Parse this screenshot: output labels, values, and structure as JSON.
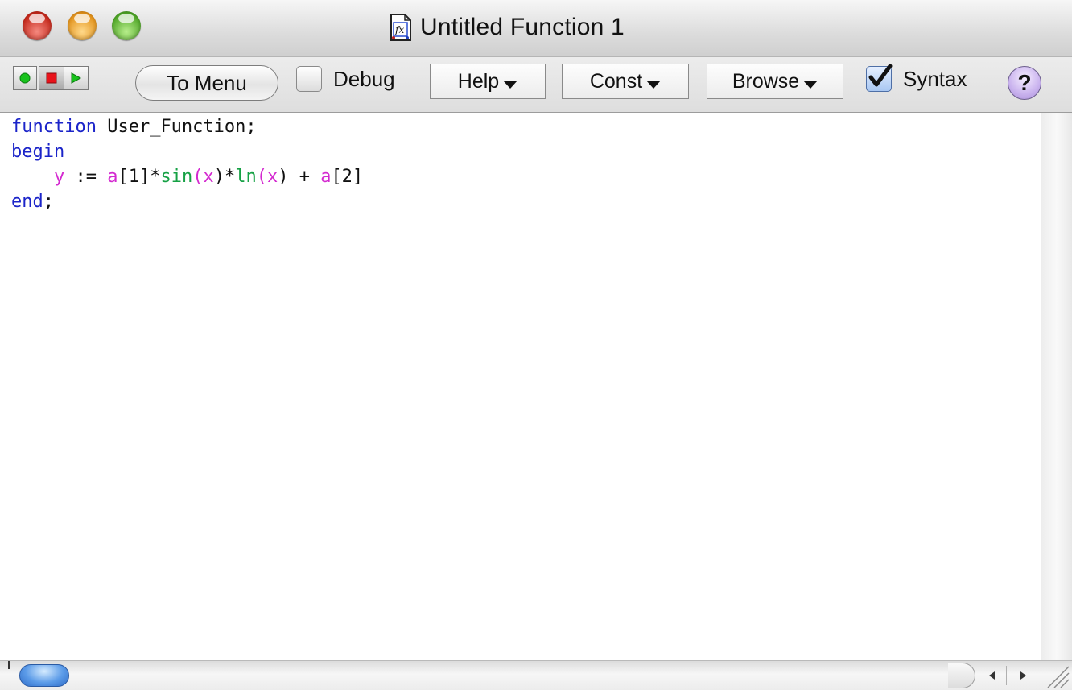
{
  "window": {
    "title": "Untitled Function 1",
    "title_icon": "function-document-icon"
  },
  "toolbar": {
    "run_green_icon": "green-dot-icon",
    "stop_icon": "red-stop-icon",
    "play_icon": "green-play-icon",
    "to_menu_label": "To Menu",
    "debug_label": "Debug",
    "debug_checked": false,
    "help_label": "Help",
    "const_label": "Const",
    "browse_label": "Browse",
    "syntax_label": "Syntax",
    "syntax_checked": true,
    "help_circle_label": "?"
  },
  "editor": {
    "code": {
      "line1_kw": "function",
      "line1_rest": " User_Function;",
      "line2_kw": "begin",
      "line3": {
        "indent": "    ",
        "y": "y",
        "assign": " := ",
        "a1": "a",
        "idx1": "[1]*",
        "sin": "sin",
        "p1open": "(",
        "x1": "x",
        "p1close": ")*",
        "ln": "ln",
        "p2open": "(",
        "x2": "x",
        "p2close": ") + ",
        "a2": "a",
        "idx2": "[2]"
      },
      "line4_kw": "end",
      "line4_rest": ";"
    }
  },
  "colors": {
    "keyword": "#1b24c9",
    "variable": "#d42ad0",
    "builtin": "#16a145"
  }
}
